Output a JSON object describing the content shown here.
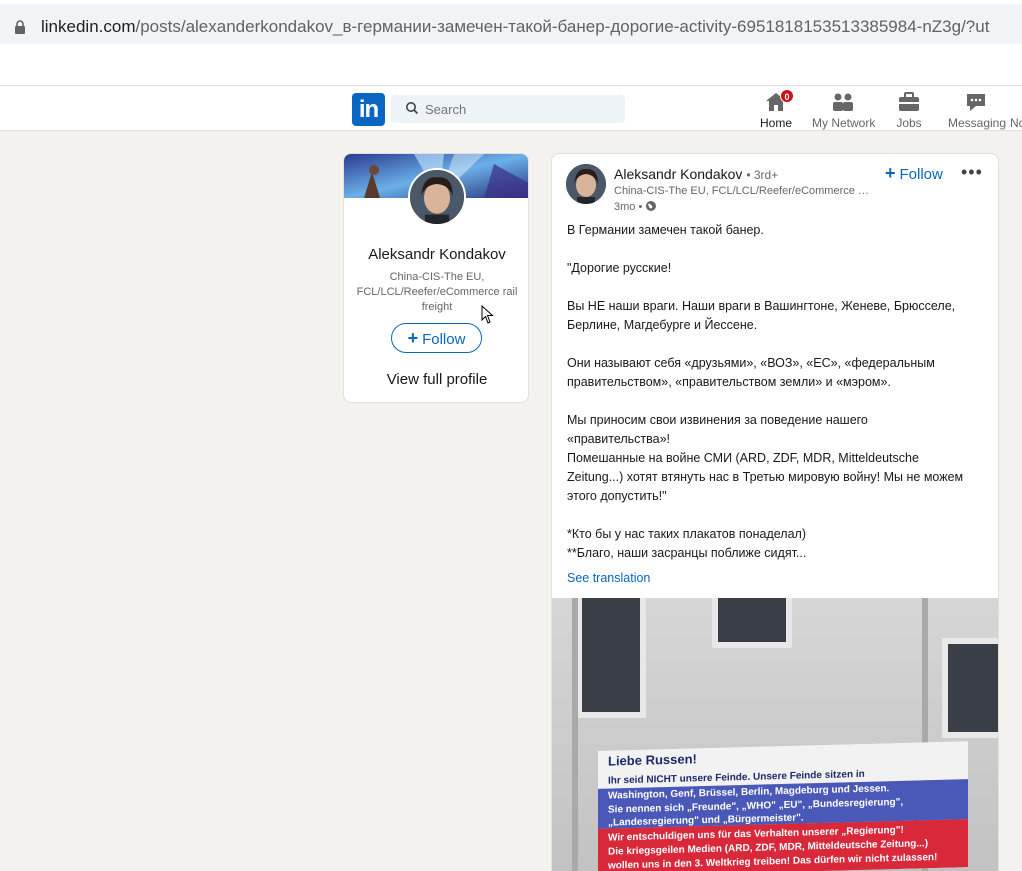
{
  "browser": {
    "url_host": "linkedin.com",
    "url_path": "/posts/alexanderkondakov_в-германии-замечен-такой-банер-дорогие-activity-6951818153513385984-nZ3g/?ut"
  },
  "nav": {
    "logo": "in",
    "search_placeholder": "Search",
    "items": [
      {
        "label": "Home",
        "badge": "0"
      },
      {
        "label": "My Network"
      },
      {
        "label": "Jobs"
      },
      {
        "label": "Messaging"
      },
      {
        "label": "No"
      }
    ]
  },
  "profile": {
    "name": "Aleksandr Kondakov",
    "headline": "China-CIS-The EU, FCL/LCL/Reefer/eCommerce rail freight",
    "follow_label": "Follow",
    "view_profile": "View full profile"
  },
  "post": {
    "author": "Aleksandr Kondakov",
    "degree": "• 3rd+",
    "headline": "China-CIS-The EU, FCL/LCL/Reefer/eCommerce r...",
    "time": "3mo •",
    "follow_label": "Follow",
    "more": "•••",
    "text": {
      "p1": "В Германии замечен такой банер.",
      "p2": "\"Дорогие русские!",
      "p3a": "Вы НЕ наши враги. Наши враги в Вашингтоне, Женеве, Брюсселе,",
      "p3b": "Берлине, Магдебурге и Йессене.",
      "p4a": "Они называют себя «друзьями», «ВОЗ», «ЕС», «федеральным",
      "p4b": "правительством», «правительством земли» и «мэром».",
      "p5a": "Мы приносим свои извинения за поведение нашего",
      "p5b": "«правительства»!",
      "p5c": "Помешанные на войне СМИ (ARD, ZDF, MDR, Mitteldeutsche",
      "p5d": "Zeitung...) хотят втянуть нас в Третью мировую войну! Мы не можем",
      "p5e": "этого допустить!\"",
      "p6a": "*Кто бы у нас таких плакатов понаделал)",
      "p6b": "**Благо, наши засранцы поближе сидят..."
    },
    "see_translation": "See translation",
    "image_banner": {
      "title": "Liebe Russen!",
      "l1": "Ihr seid NICHT unsere Feinde. Unsere Feinde sitzen in",
      "l2": "Washington, Genf, Brüssel, Berlin, Magdeburg und Jessen.",
      "l3": "Sie nennen sich „Freunde\", „WHO\" „EU\", „Bundesregierung\",",
      "l4": "„Landesregierung\" und „Bürgermeister\".",
      "l5": "Wir entschuldigen uns für das Verhalten unserer „Regierung\"!",
      "l6": "Die kriegsgeilen Medien (ARD, ZDF, MDR, Mitteldeutsche Zeitung...)",
      "l7": "wollen uns in den 3. Weltkrieg treiben! Das dürfen wir nicht zulassen!"
    }
  },
  "colors": {
    "linkedin_blue": "#0a66c2",
    "badge_red": "#cc1016",
    "page_bg": "#f3f2ef"
  }
}
